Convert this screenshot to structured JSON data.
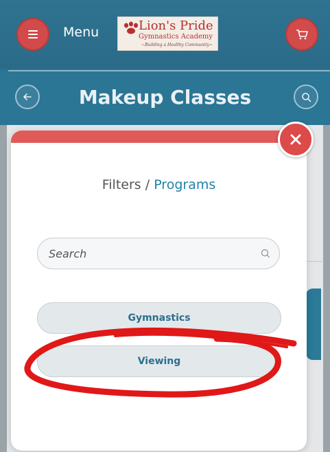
{
  "topbar": {
    "menu_label": "Menu",
    "logo": {
      "brand": "Lion's Pride",
      "subtitle": "Gymnastics Academy",
      "tagline": "~Building a Healthy Community~"
    }
  },
  "header": {
    "title": "Makeup Classes"
  },
  "modal": {
    "breadcrumb_root": "Filters",
    "breadcrumb_sep": " / ",
    "breadcrumb_current": "Programs",
    "search_placeholder": "Search",
    "programs": [
      {
        "label": "Gymnastics"
      },
      {
        "label": "Viewing"
      }
    ]
  },
  "icons": {
    "menu": "hamburger-icon",
    "cart": "cart-icon",
    "back": "arrow-left-icon",
    "search": "search-icon",
    "close": "close-icon"
  },
  "colors": {
    "primary": "#2b7595",
    "accent_red": "#d24a4a",
    "link_blue": "#1f82a8",
    "annotation_red": "#e01818"
  }
}
